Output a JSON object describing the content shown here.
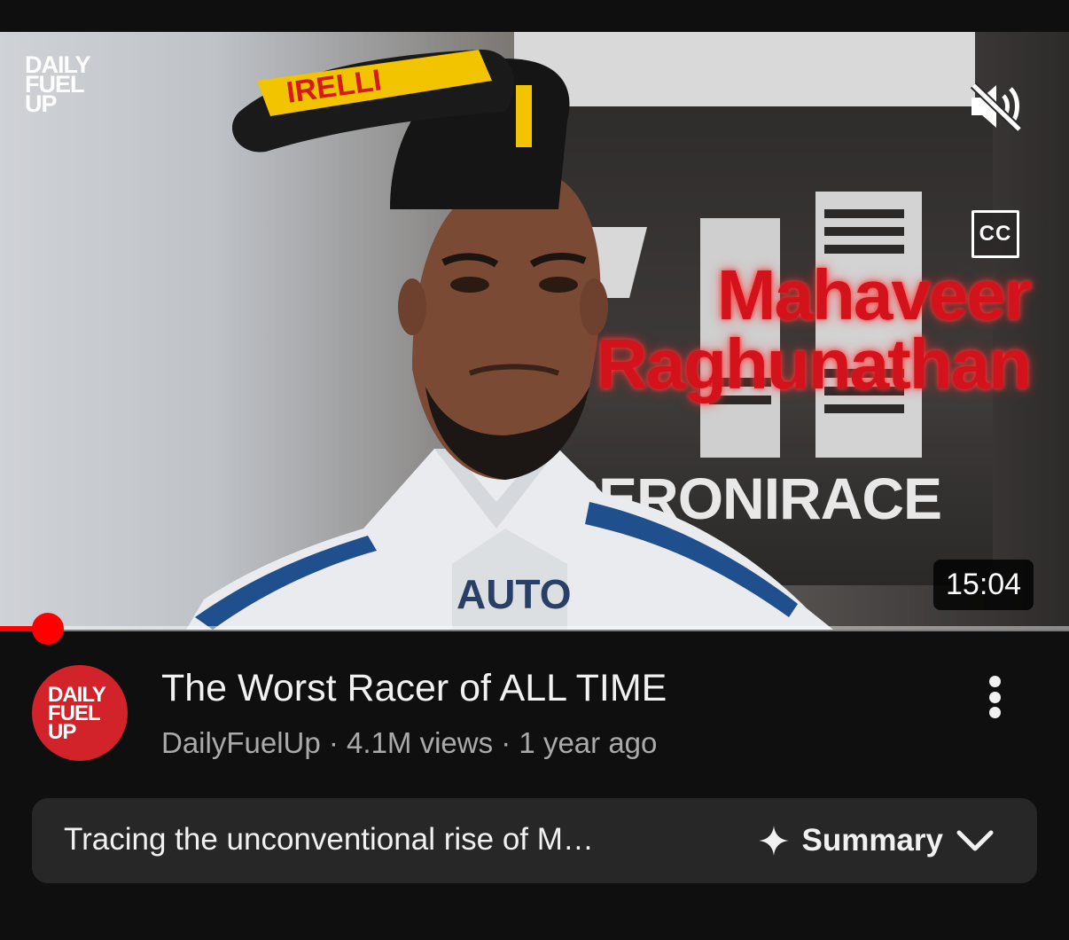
{
  "video": {
    "watermark": [
      "DAILY",
      "FUEL",
      "UP"
    ],
    "overlay_name": [
      "Mahaveer",
      "Raghunathan"
    ],
    "cc_label": "CC",
    "duration": "15:04",
    "progress": 0.045,
    "background_text": "PERONIRACE"
  },
  "channel": {
    "avatar_text": [
      "DAILY",
      "FUEL",
      "UP"
    ],
    "avatar_color": "#d2232a"
  },
  "meta": {
    "title": "The Worst Racer of ALL TIME",
    "byline": "DailyFuelUp · 4.1M views · 1 year ago"
  },
  "summary": {
    "text": "Tracing the unconventional rise of M…",
    "button_label": "Summary"
  },
  "colors": {
    "accent_red": "#ff0000",
    "overlay_red": "#d3121b",
    "background": "#0f0f0f",
    "card": "#272727"
  },
  "icons": [
    "mute-icon",
    "cc-icon",
    "more-vert-icon",
    "sparkle-icon",
    "chevron-down-icon"
  ]
}
